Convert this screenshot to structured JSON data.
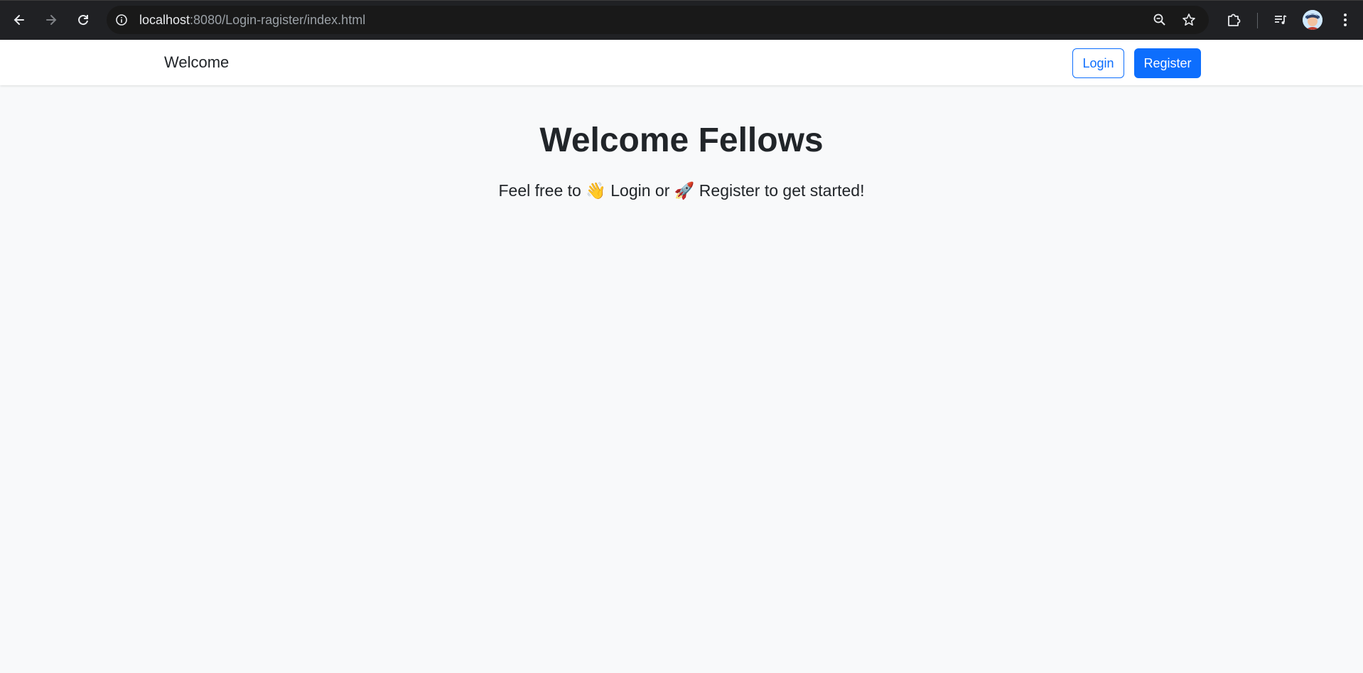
{
  "browser": {
    "url_host": "localhost",
    "url_rest": ":8080/Login-ragister/index.html",
    "icons": {
      "back": "back-arrow-icon",
      "forward": "forward-arrow-icon",
      "reload": "reload-icon",
      "info": "site-info-icon",
      "zoom": "zoom-icon",
      "bookmark": "star-icon",
      "extensions": "puzzle-icon",
      "media": "media-queue-icon",
      "profile": "avatar",
      "menu": "kebab-menu-icon"
    }
  },
  "navbar": {
    "brand": "Welcome",
    "login_label": "Login",
    "register_label": "Register"
  },
  "hero": {
    "title": "Welcome Fellows",
    "sub_prefix": "Feel free to ",
    "wave_emoji": "👋",
    "sub_login": " Login or ",
    "rocket_emoji": "🚀",
    "sub_register": " Register to get started!"
  },
  "colors": {
    "primary": "#0d6efd",
    "page_bg": "#f8f9fa",
    "text": "#212529",
    "chrome_bg": "#202124"
  }
}
